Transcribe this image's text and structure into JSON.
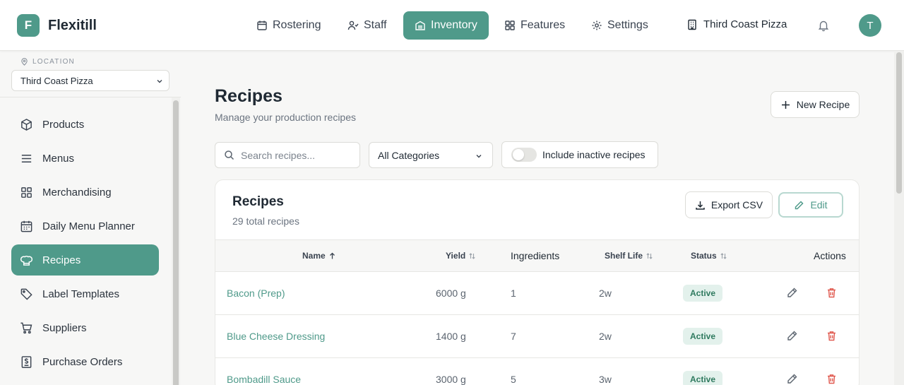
{
  "app": {
    "logo_letter": "F",
    "name": "Flexitill"
  },
  "nav": [
    {
      "label": "Rostering",
      "icon": "calendar-icon"
    },
    {
      "label": "Staff",
      "icon": "users-icon"
    },
    {
      "label": "Inventory",
      "icon": "inventory-icon",
      "active": true
    },
    {
      "label": "Features",
      "icon": "grid-icon"
    },
    {
      "label": "Settings",
      "icon": "gear-icon"
    }
  ],
  "header": {
    "store_name": "Third Coast Pizza",
    "avatar_letter": "T"
  },
  "sidebar": {
    "location_label": "LOCATION",
    "location_value": "Third Coast Pizza",
    "items": [
      {
        "label": "Products",
        "icon": "box-icon"
      },
      {
        "label": "Menus",
        "icon": "menu-icon"
      },
      {
        "label": "Merchandising",
        "icon": "grid-icon"
      },
      {
        "label": "Daily Menu Planner",
        "icon": "calendar-icon"
      },
      {
        "label": "Recipes",
        "icon": "chef-hat-icon",
        "active": true
      },
      {
        "label": "Label Templates",
        "icon": "tag-icon"
      },
      {
        "label": "Suppliers",
        "icon": "cart-icon"
      },
      {
        "label": "Purchase Orders",
        "icon": "receipt-icon"
      }
    ]
  },
  "page": {
    "title": "Recipes",
    "subtitle": "Manage your production recipes",
    "new_button": "New Recipe",
    "search_placeholder": "Search recipes...",
    "category_value": "All Categories",
    "inactive_toggle_label": "Include inactive recipes",
    "inactive_toggle_on": false
  },
  "card": {
    "title": "Recipes",
    "subtitle": "29 total recipes",
    "export_label": "Export CSV",
    "edit_label": "Edit"
  },
  "table": {
    "columns": {
      "name": "Name",
      "yield": "Yield",
      "ingredients": "Ingredients",
      "shelf_life": "Shelf Life",
      "status": "Status",
      "actions": "Actions"
    },
    "rows": [
      {
        "name": "Bacon (Prep)",
        "yield": "6000 g",
        "ingredients": "1",
        "shelf_life": "2w",
        "status": "Active"
      },
      {
        "name": "Blue Cheese Dressing",
        "yield": "1400 g",
        "ingredients": "7",
        "shelf_life": "2w",
        "status": "Active"
      },
      {
        "name": "Bombadill Sauce",
        "yield": "3000 g",
        "ingredients": "5",
        "shelf_life": "3w",
        "status": "Active"
      }
    ]
  },
  "colors": {
    "accent": "#4f9a8a",
    "badge_bg": "#e3f1ec",
    "badge_text": "#2f7a5f",
    "delete": "#e0594f"
  }
}
